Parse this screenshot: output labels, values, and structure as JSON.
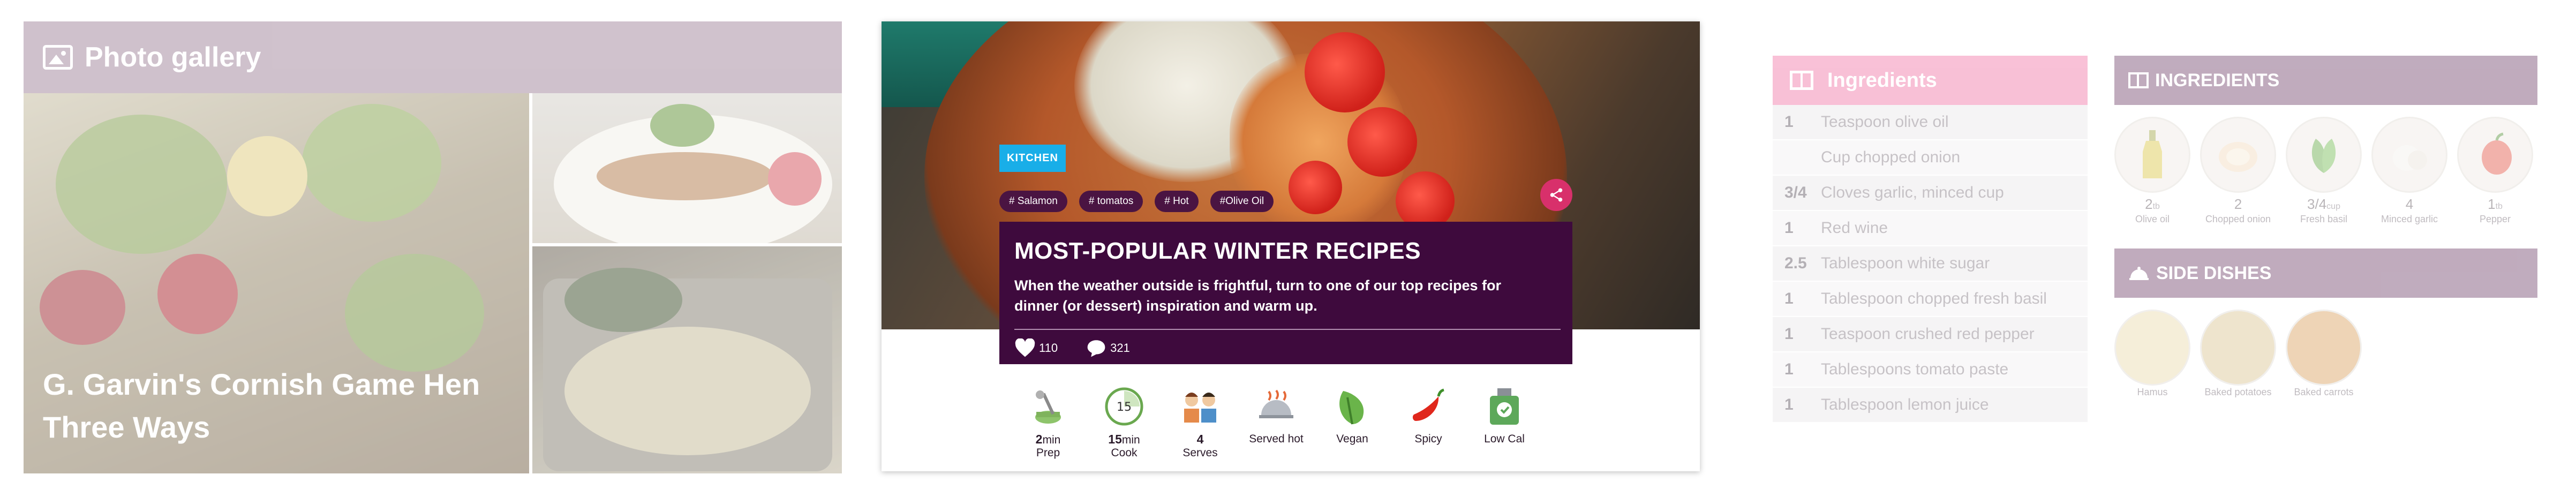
{
  "gallery": {
    "title": "Photo gallery",
    "caption": "G. Garvin's Cornish Game Hen Three Ways",
    "icon": "image-icon"
  },
  "recipe": {
    "category_badge": "KITCHEN",
    "tags": [
      "# Salamon",
      "# tomatos",
      "# Hot",
      "#Olive Oil"
    ],
    "title": "MOST-POPULAR WINTER RECIPES",
    "description": "When the weather outside is frightful, turn to one of our top recipes for dinner (or dessert) inspiration and warm up.",
    "likes": "110",
    "comments": "321",
    "meta": [
      {
        "icon": "mixer-icon",
        "value": "2",
        "unit": "min",
        "label": "Prep"
      },
      {
        "icon": "timer-icon",
        "value": "15",
        "unit": "min",
        "label": "Cook"
      },
      {
        "icon": "people-icon",
        "value": "4",
        "unit": "",
        "label": "Serves"
      },
      {
        "icon": "cloche-icon",
        "value": "",
        "unit": "",
        "label": "Served hot"
      },
      {
        "icon": "leaf-icon",
        "value": "",
        "unit": "",
        "label": "Vegan"
      },
      {
        "icon": "chili-icon",
        "value": "",
        "unit": "",
        "label": "Spicy"
      },
      {
        "icon": "scale-icon",
        "value": "",
        "unit": "",
        "label": "Low Cal"
      }
    ],
    "colors": {
      "badge": "#19aee8",
      "panel": "#3e0a3d",
      "share": "#d8306b"
    }
  },
  "ingredients": {
    "title": "Ingredients",
    "rows": [
      {
        "q": "1",
        "name": "Teaspoon olive oil"
      },
      {
        "q": "",
        "name": "Cup chopped onion"
      },
      {
        "q": "3/4",
        "name": "Cloves garlic, minced cup"
      },
      {
        "q": "1",
        "name": "Red wine"
      },
      {
        "q": "2.5",
        "name": "Tablespoon white sugar"
      },
      {
        "q": "1",
        "name": "Tablespoon chopped fresh basil"
      },
      {
        "q": "1",
        "name": "Teaspoon crushed red pepper"
      },
      {
        "q": "1",
        "name": "Tablespoons tomato paste"
      },
      {
        "q": "1",
        "name": "Tablespoon lemon juice"
      }
    ]
  },
  "ingredients_visual": {
    "title": "INGREDIENTS",
    "items": [
      {
        "n": "2",
        "u": "tb",
        "t": "Olive oil"
      },
      {
        "n": "2",
        "u": "",
        "t": "Chopped onion"
      },
      {
        "n": "3/4",
        "u": "cup",
        "t": "Fresh basil"
      },
      {
        "n": "4",
        "u": "",
        "t": "Minced garlic"
      },
      {
        "n": "1",
        "u": "tb",
        "t": "Pepper"
      }
    ]
  },
  "side_dishes": {
    "title": "SIDE DISHES",
    "items": [
      {
        "t": "Hamus"
      },
      {
        "t": "Baked potatoes"
      },
      {
        "t": "Baked carrots"
      }
    ]
  }
}
